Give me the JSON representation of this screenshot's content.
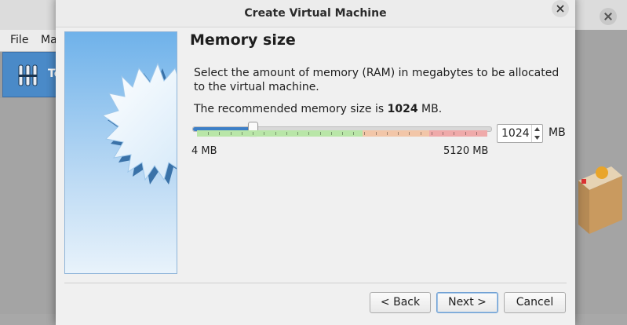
{
  "background_window": {
    "menu": {
      "file": "File",
      "machine": "Ma"
    },
    "tools_label": "To"
  },
  "dialog": {
    "title": "Create Virtual Machine",
    "heading": "Memory size",
    "description": "Select the amount of memory (RAM) in megabytes to be allocated to the virtual machine.",
    "recommend_prefix": "The recommended memory size is ",
    "recommend_value": "1024",
    "recommend_suffix": " MB.",
    "memory": {
      "value": "1024",
      "unit": "MB",
      "min_label": "4 MB",
      "max_label": "5120 MB",
      "slider_fraction": 0.2
    },
    "buttons": {
      "back": "< Back",
      "next": "Next >",
      "cancel": "Cancel"
    }
  },
  "colors": {
    "slider_fill": "#3d7fc7",
    "scale_green": "#b9e6a8",
    "scale_orange": "#f2c6a8",
    "scale_red": "#efaaaa",
    "side_image_sky": "#6fb2ea",
    "accent_tools": "#4a8ac8"
  }
}
